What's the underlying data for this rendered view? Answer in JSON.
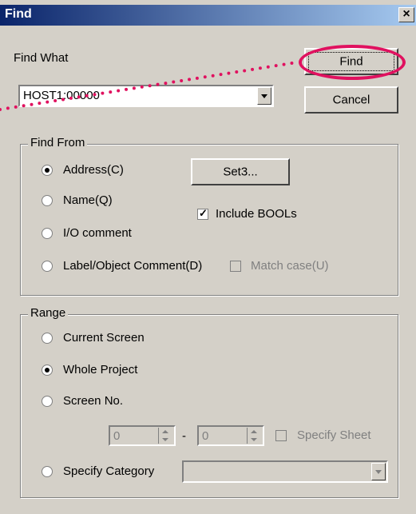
{
  "window": {
    "title": "Find",
    "close_label": "×"
  },
  "find_what": {
    "label": "Find What",
    "value": "HOST1:00000"
  },
  "buttons": {
    "find": "Find",
    "cancel": "Cancel",
    "set3": "Set3..."
  },
  "find_from": {
    "title": "Find From",
    "options": [
      {
        "label": "Address(C)",
        "checked": true
      },
      {
        "label": "Name(Q)",
        "checked": false
      },
      {
        "label": "I/O comment",
        "checked": false
      },
      {
        "label": "Label/Object Comment(D)",
        "checked": false
      }
    ],
    "include_bools": "Include BOOLs",
    "match_case": "Match case(U)"
  },
  "range": {
    "title": "Range",
    "options": [
      {
        "label": "Current Screen",
        "checked": false
      },
      {
        "label": "Whole Project",
        "checked": true
      },
      {
        "label": "Screen No.",
        "checked": false
      },
      {
        "label": "Specify Category",
        "checked": false
      }
    ],
    "from_value": "0",
    "dash": "-",
    "to_value": "0",
    "specify_sheet": "Specify Sheet"
  },
  "colors": {
    "highlight": "#e0115f"
  }
}
